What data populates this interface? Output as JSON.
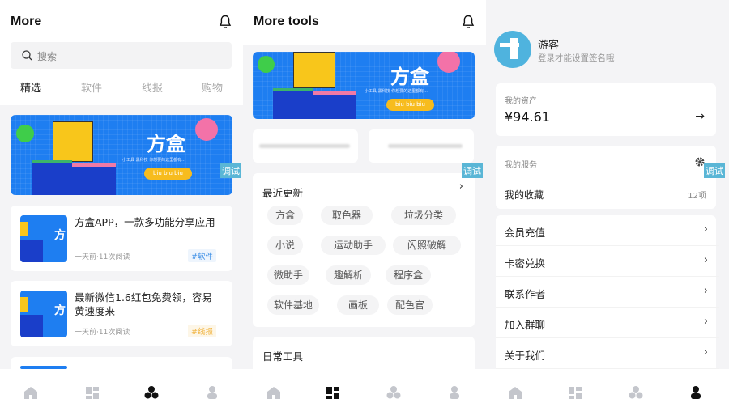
{
  "panel1": {
    "title": "More",
    "search_placeholder": "搜索",
    "tabs": [
      "精选",
      "软件",
      "线报",
      "购物"
    ],
    "banner": {
      "brand": "方盒",
      "subtitle": "小工具 黑科技 你想要的这里都有...",
      "button": "biu biu biu"
    },
    "debug_label": "调试",
    "articles": [
      {
        "title": "方盒APP，一款多功能分享应用",
        "meta": "一天前·11次阅读",
        "tag": "#软件",
        "tag_color": "#3b8ee6",
        "tag_bg": "#eef5fd"
      },
      {
        "title": "最新微信1.6红包免费领，容易黄速度来",
        "meta": "一天前·11次阅读",
        "tag": "#线报",
        "tag_color": "#f1b441",
        "tag_bg": "#fdf6e7"
      }
    ]
  },
  "panel2": {
    "title": "More tools",
    "banner": {
      "brand": "方盒",
      "subtitle": "小工具 黑科技 你想要的这里都有...",
      "button": "biu biu biu"
    },
    "debug_label": "调试",
    "recent": {
      "title": "最近更新",
      "chips": [
        [
          "方盒",
          "取色器",
          "垃圾分类"
        ],
        [
          "小说",
          "运动助手",
          "闪照破解"
        ],
        [
          "微助手",
          "趣解析",
          "程序盒"
        ],
        [
          "软件基地",
          "画板",
          "配色官"
        ]
      ]
    },
    "daily": {
      "title": "日常工具"
    }
  },
  "panel3": {
    "user": {
      "name": "游客",
      "signature": "登录才能设置签名哦"
    },
    "assets": {
      "label": "我的资产",
      "amount": "¥94.61"
    },
    "services": {
      "label": "我的服务",
      "favorites_label": "我的收藏",
      "favorites_count": "12项"
    },
    "debug_label": "调试",
    "menu": [
      "会员充值",
      "卡密兑换",
      "联系作者",
      "加入群聊",
      "关于我们"
    ]
  },
  "tabbar": {
    "items": [
      "home",
      "tools",
      "discover",
      "profile"
    ],
    "active_color": "#111111",
    "inactive_color": "#c4c6cc"
  },
  "colors": {
    "brand_blue": "#1e7ef1",
    "avatar_blue": "#4fb3de",
    "debug_badge": "#5ab6d6"
  }
}
